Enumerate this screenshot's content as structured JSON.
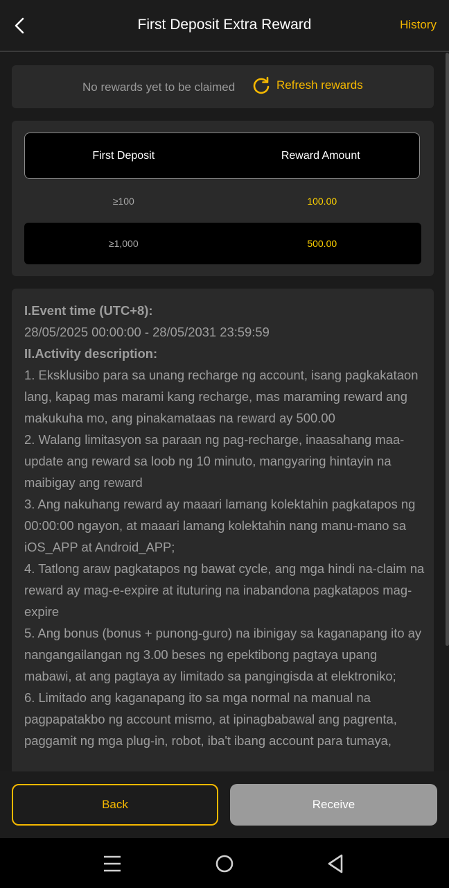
{
  "header": {
    "title": "First Deposit Extra Reward",
    "history_label": "History"
  },
  "notice": {
    "text": "No rewards yet to be claimed",
    "refresh_label": "Refresh rewards"
  },
  "reward_table": {
    "columns": [
      "First Deposit",
      "Reward Amount"
    ],
    "rows": [
      {
        "deposit": "≥100",
        "reward": "100.00"
      },
      {
        "deposit": "≥1,000",
        "reward": "500.00"
      }
    ]
  },
  "description": {
    "lines": [
      {
        "text": "I.Event time (UTC+8):",
        "bold": true
      },
      {
        "text": "28/05/2025 00:00:00 - 28/05/2031 23:59:59",
        "bold": false
      },
      {
        "text": "II.Activity description:",
        "bold": true
      },
      {
        "text": "1. Eksklusibo para sa unang recharge ng account, isang pagkakataon lang, kapag mas marami kang recharge, mas maraming reward ang makukuha mo, ang pinakamataas na reward ay 500.00",
        "bold": false
      },
      {
        "text": "2. Walang limitasyon sa paraan ng pag-recharge, inaasahang maa-update ang reward sa loob ng 10 minuto, mangyaring hintayin na maibigay ang reward",
        "bold": false
      },
      {
        "text": "3. Ang nakuhang reward ay maaari lamang kolektahin pagkatapos ng 00:00:00 ngayon, at maaari lamang kolektahin nang manu-mano sa iOS_APP at Android_APP;",
        "bold": false
      },
      {
        "text": "4. Tatlong araw pagkatapos ng bawat cycle, ang mga hindi na-claim na reward ay mag-e-expire at ituturing na inabandona pagkatapos mag-expire",
        "bold": false
      },
      {
        "text": "5. Ang bonus (bonus + punong-guro) na ibinigay sa kaganapang ito ay nangangailangan ng 3.00 beses ng epektibong pagtaya upang mabawi, at ang pagtaya ay limitado sa pangingisda at elektroniko;",
        "bold": false
      },
      {
        "text": "6. Limitado ang kaganapang ito sa mga normal na manual na pagpapatakbo ng account mismo, at ipinagbabawal ang pagrenta, paggamit ng mga plug-in, robot, iba't ibang account para tumaya,",
        "bold": false
      }
    ]
  },
  "actions": {
    "back_label": "Back",
    "receive_label": "Receive"
  },
  "colors": {
    "accent": "#f5b800",
    "reward_value": "#ffd200",
    "background": "#1b1b1b",
    "card": "#2a2a2a",
    "disabled_button": "#9b9b9b"
  },
  "icons": {
    "back": "chevron-left-icon",
    "refresh": "refresh-icon",
    "nav_menu": "menu-icon",
    "nav_home": "home-circle-icon",
    "nav_back": "triangle-back-icon"
  }
}
